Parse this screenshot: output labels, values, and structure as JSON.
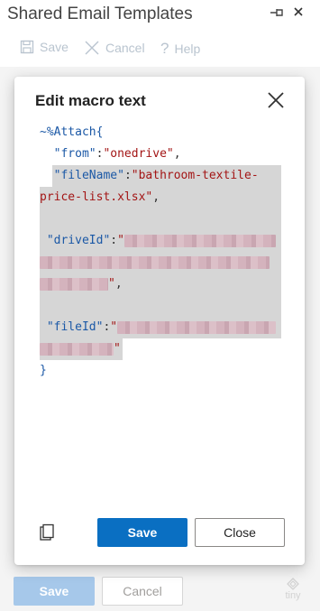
{
  "pane": {
    "title": "Shared Email Templates",
    "pin_icon": "pin-icon",
    "close_icon": "close-icon"
  },
  "toolbar": {
    "save_label": "Save",
    "cancel_label": "Cancel",
    "help_label": "Help"
  },
  "modal": {
    "title": "Edit macro text",
    "code": {
      "macro_open": "~%Attach{",
      "from_key": "\"from\"",
      "from_value": "\"onedrive\"",
      "filename_key": "\"fileName\"",
      "filename_value_1": "\"bathroom-textile-",
      "filename_value_2": "price-list.xlsx\"",
      "driveid_key": "\"driveId\"",
      "fileid_key": "\"fileId\"",
      "close_brace": "}",
      "colon": ":",
      "comma": ","
    },
    "save_label": "Save",
    "close_label": "Close"
  },
  "footer": {
    "save_label": "Save",
    "cancel_label": "Cancel",
    "brand": "tiny"
  },
  "colors": {
    "primary": "#0a6fc2",
    "primary_disabled": "#a6c8ea",
    "selection": "#d6d6d6",
    "string": "#a31515",
    "keyword": "#1b58a6"
  }
}
